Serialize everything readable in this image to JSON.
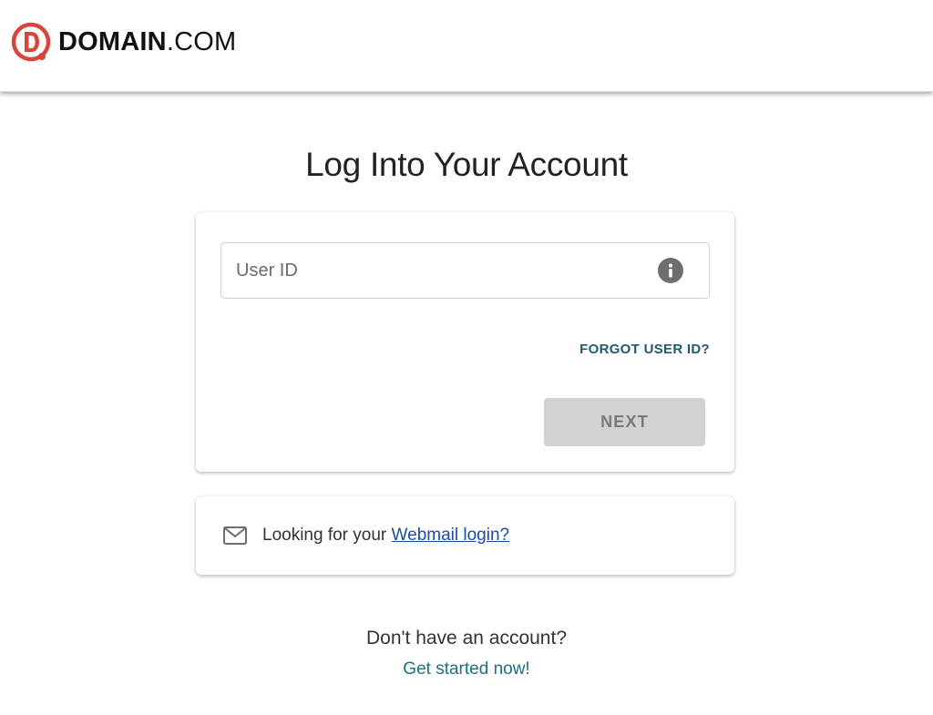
{
  "header": {
    "logo": {
      "icon": "domain-d-logo-icon",
      "brand_bold": "DOMAIN",
      "brand_thin": ".COM",
      "brand_color": "#d9453a"
    }
  },
  "main": {
    "title": "Log Into Your Account"
  },
  "login_form": {
    "user_id": {
      "placeholder": "User ID",
      "value": "",
      "info_icon": "info-icon"
    },
    "forgot_link": "FORGOT USER ID?",
    "next_label": "NEXT",
    "next_disabled": true
  },
  "webmail": {
    "icon": "envelope-icon",
    "prefix": "Looking for your ",
    "link": "Webmail login?"
  },
  "signup": {
    "prompt": "Don't have an account?",
    "link": "Get started now!"
  },
  "colors": {
    "link_teal": "#1f5a72",
    "webmail_link_blue": "#1d4aa8",
    "signup_link": "#1e6f80",
    "disabled_button": "#d2d2d2"
  }
}
